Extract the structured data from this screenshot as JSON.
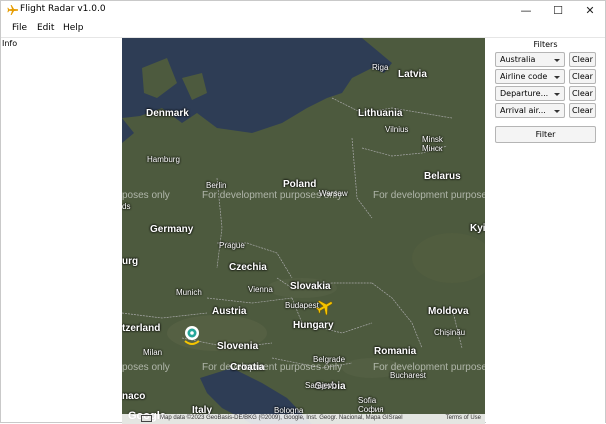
{
  "window": {
    "title": "Flight Radar v1.0.0",
    "icon": "airplane-icon",
    "controls": {
      "minimize": "—",
      "maximize": "☐",
      "close": "✕"
    }
  },
  "menu": [
    "File",
    "Edit",
    "Help"
  ],
  "info": {
    "label": "Info"
  },
  "map": {
    "countries": [
      "Latvia",
      "Denmark",
      "Lithuania",
      "Belarus",
      "Poland",
      "Germany",
      "Czechia",
      "Slovakia",
      "Austria",
      "Hungary",
      "Moldova",
      "Slovenia",
      "Croatia",
      "Romania",
      "Serbia",
      "Italy",
      "tzerland",
      "Kyi Кию",
      "urg",
      "naco"
    ],
    "cities": [
      "Riga",
      "Vilnius",
      "Minsk",
      "Мінск",
      "Hamburg",
      "Berlin",
      "Warsaw",
      "Prague",
      "Munich",
      "Vienna",
      "Budapest",
      "Milan",
      "Chișinău",
      "Belgrade",
      "Bucharest",
      "Sarajevo",
      "Sofia",
      "София",
      "Bologna",
      "ds"
    ],
    "watermarks": [
      "poses only",
      "For development purposes only",
      "For development purpose",
      "For development purposes only",
      "poses only",
      "For development purpose"
    ],
    "attribution": "Map data ©2023 GeoBasis-DE/BKG (©2009), Google, Inst. Geogr. Nacional, Mapa GISrael",
    "terms": "Terms of Use",
    "google": "Google",
    "plane_color": "#f5c400",
    "marker_icon": "location-pin-icon",
    "water_color": "#2e3d55",
    "land_color": "#4d5a3e"
  },
  "filters": {
    "title": "Filters",
    "rows": [
      {
        "value": "Australia",
        "clear": "Clear"
      },
      {
        "value": "Airline code",
        "clear": "Clear"
      },
      {
        "value": "Departure...",
        "clear": "Clear"
      },
      {
        "value": "Arrival air...",
        "clear": "Clear"
      }
    ],
    "filter_button": "Filter"
  }
}
